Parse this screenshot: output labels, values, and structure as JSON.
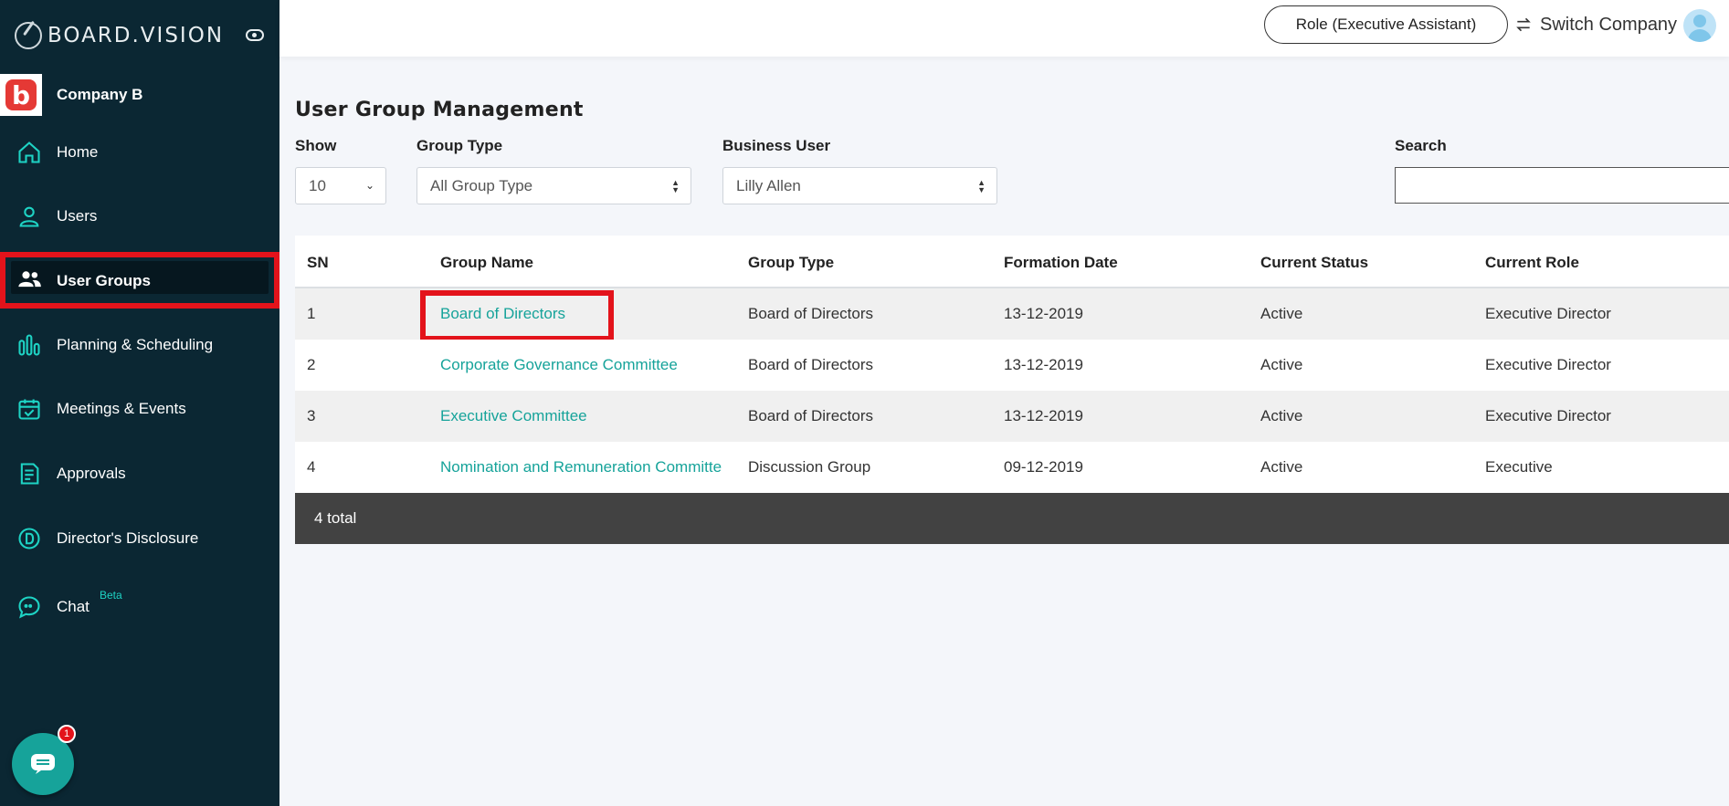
{
  "brand": {
    "name": "BOARD.VISION"
  },
  "company": {
    "logo_letter": "b",
    "name": "Company B"
  },
  "sidebar": {
    "items": [
      {
        "label": "Home",
        "icon": "home-icon"
      },
      {
        "label": "Users",
        "icon": "user-icon"
      },
      {
        "label": "User Groups",
        "icon": "user-group-icon"
      },
      {
        "label": "Planning & Scheduling",
        "icon": "bar-chart-icon"
      },
      {
        "label": "Meetings & Events",
        "icon": "calendar-icon"
      },
      {
        "label": "Approvals",
        "icon": "document-icon"
      },
      {
        "label": "Director's Disclosure",
        "icon": "d-circle-icon"
      },
      {
        "label": "Chat",
        "icon": "chat-icon",
        "badge": "Beta"
      }
    ],
    "active": "User Groups"
  },
  "chat_widget": {
    "badge_count": "1"
  },
  "topbar": {
    "role_button": "Role (Executive Assistant)",
    "switch_company": "Switch Company"
  },
  "page": {
    "title": "User Group Management"
  },
  "filters": {
    "show": {
      "label": "Show",
      "value": "10"
    },
    "group_type": {
      "label": "Group Type",
      "value": "All Group Type"
    },
    "business_user": {
      "label": "Business User",
      "value": "Lilly Allen"
    },
    "search": {
      "label": "Search",
      "value": "",
      "placeholder": ""
    }
  },
  "table": {
    "headers": [
      "SN",
      "Group Name",
      "Group Type",
      "Formation Date",
      "Current Status",
      "Current Role"
    ],
    "rows": [
      {
        "sn": "1",
        "group_name": "Board of Directors",
        "group_type": "Board of Directors",
        "formation_date": "13-12-2019",
        "status": "Active",
        "role": "Executive Director"
      },
      {
        "sn": "2",
        "group_name": "Corporate Governance Committee",
        "group_type": "Board of Directors",
        "formation_date": "13-12-2019",
        "status": "Active",
        "role": "Executive Director"
      },
      {
        "sn": "3",
        "group_name": "Executive Committee",
        "group_type": "Board of Directors",
        "formation_date": "13-12-2019",
        "status": "Active",
        "role": "Executive Director"
      },
      {
        "sn": "4",
        "group_name": "Nomination and Remuneration Committe",
        "group_type": "Discussion Group",
        "formation_date": "09-12-2019",
        "status": "Active",
        "role": "Executive"
      }
    ],
    "footer": "4 total"
  },
  "colors": {
    "sidebar_bg": "#0b2733",
    "accent": "#16a39a",
    "highlight": "#e3131b",
    "footer_bg": "#424242"
  }
}
